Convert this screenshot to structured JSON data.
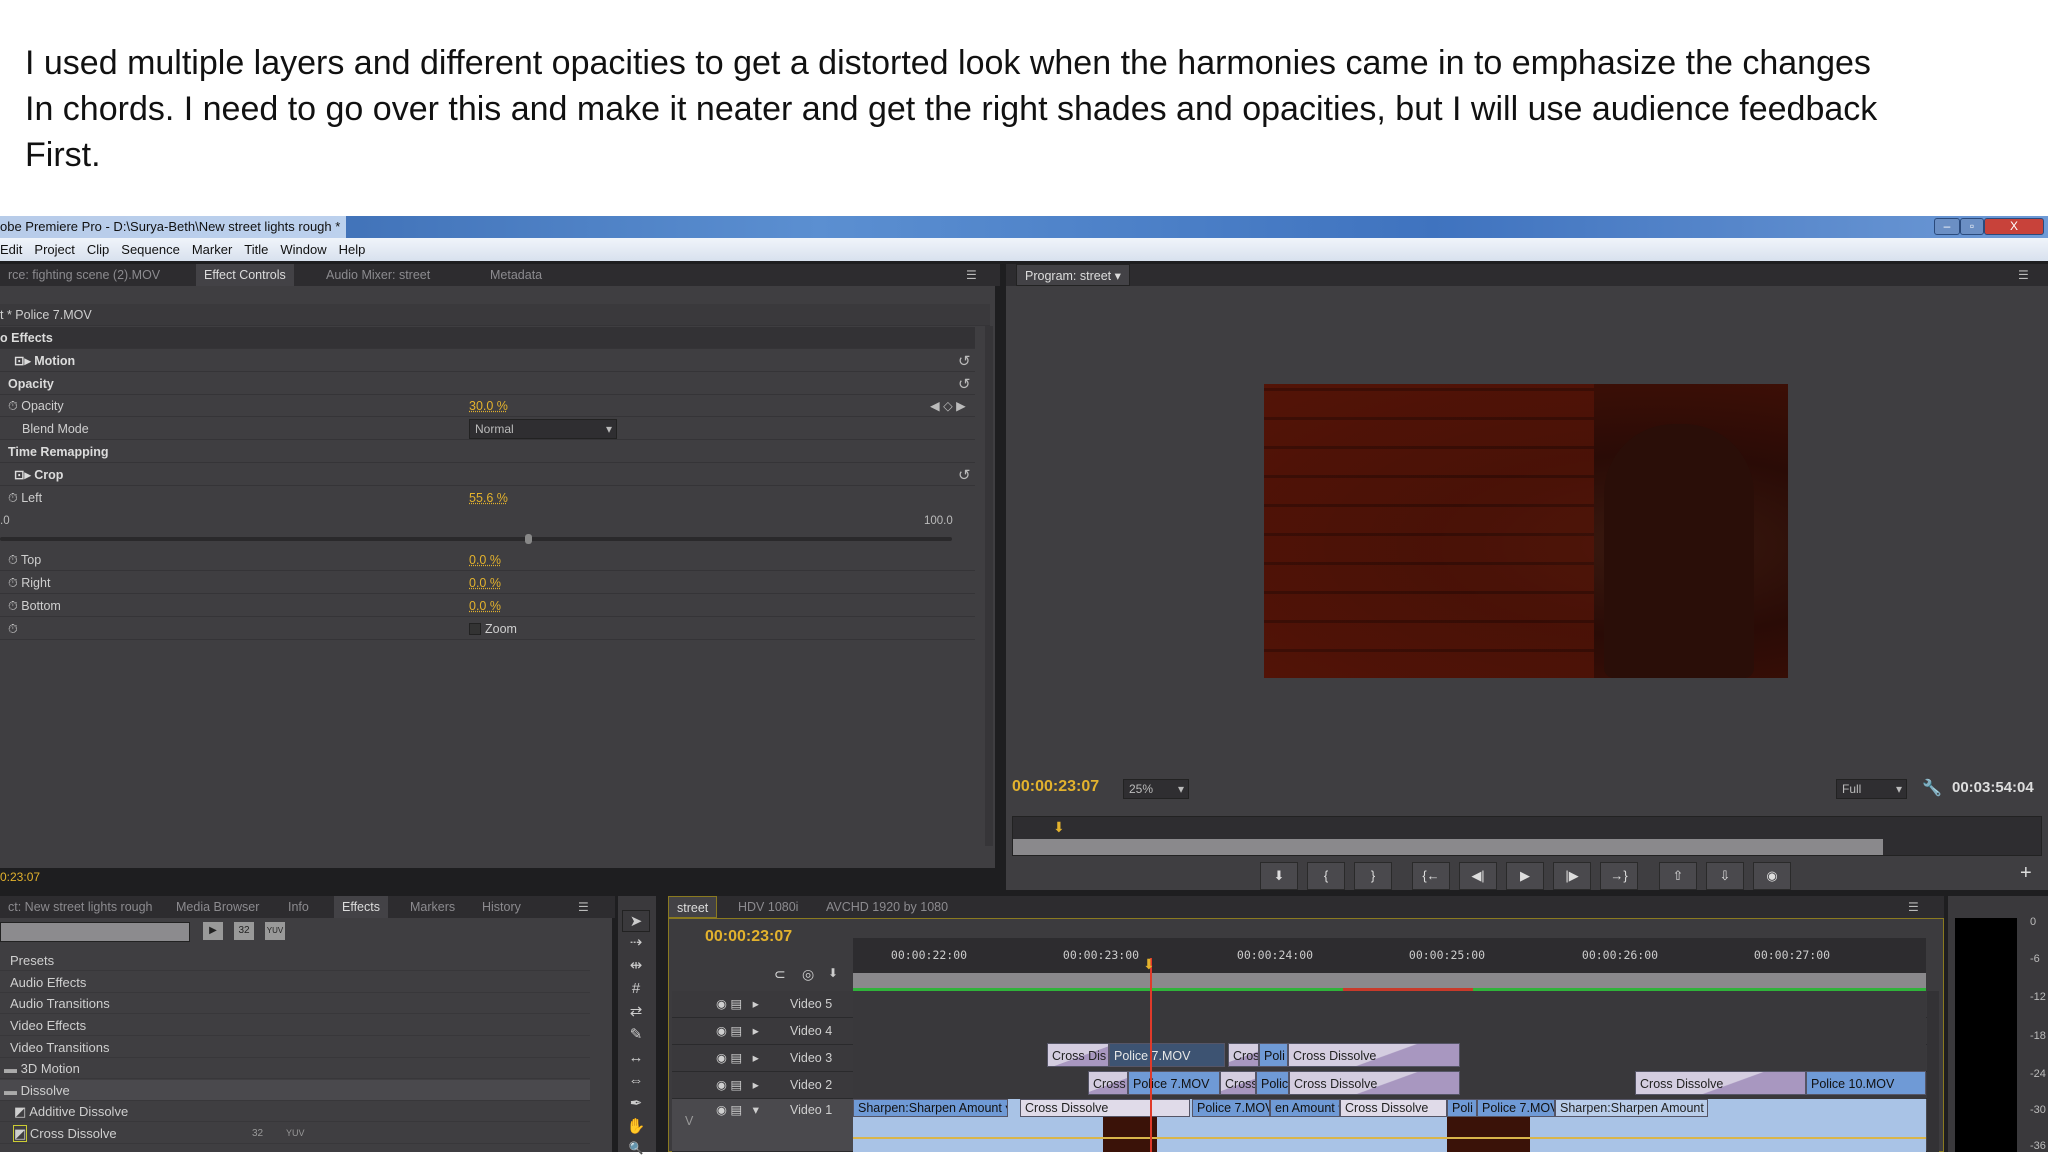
{
  "note": {
    "lines": [
      "I used multiple layers  and different opacities to get a distorted look when the harmonies came in to emphasize the  changes",
      "In chords. I need to go over this and make it neater and get the right shades and opacities, but I will use audience feedback",
      "First."
    ]
  },
  "window": {
    "title": "obe Premiere Pro - D:\\Surya-Beth\\New street lights rough *",
    "min": "–",
    "max": "▫",
    "close": "X"
  },
  "menu": [
    "Edit",
    "Project",
    "Clip",
    "Sequence",
    "Marker",
    "Title",
    "Window",
    "Help"
  ],
  "source_tabs": [
    "rce: fighting scene (2).MOV",
    "Effect Controls",
    "Audio Mixer: street",
    "Metadata"
  ],
  "effect_controls": {
    "clip": "t * Police 7.MOV",
    "section": "o Effects",
    "motion": "Motion",
    "opacity_group": "Opacity",
    "opacity_label": "Opacity",
    "opacity_value": "30.0 %",
    "blend_label": "Blend Mode",
    "blend_value": "Normal",
    "time_remap": "Time Remapping",
    "crop": "Crop",
    "left_label": "Left",
    "left_value": "55.6 %",
    "slider_min": ".0",
    "slider_max": "100.0",
    "slider_value": 55.6,
    "top_label": "Top",
    "top_value": "0.0 %",
    "right_label": "Right",
    "right_value": "0.0 %",
    "bottom_label": "Bottom",
    "bottom_value": "0.0 %",
    "zoom_label": "Zoom",
    "zoom_checked": false,
    "timecode": "0:23:07"
  },
  "program": {
    "tab": "Program: street",
    "timecode": "00:00:23:07",
    "zoom": "25%",
    "quality": "Full",
    "duration": "00:03:54:04",
    "buttons": [
      "marker",
      "mark-in",
      "mark-out",
      "go-to-in",
      "step-back",
      "play",
      "step-forward",
      "go-to-out",
      "lift",
      "extract",
      "export-frame"
    ],
    "button_glyphs": [
      "⬇",
      "{",
      "}",
      "{←",
      "◀|",
      "▶",
      "|▶",
      "→}",
      "⇧",
      "⇩",
      "◉"
    ],
    "add": "+"
  },
  "project_tabs": [
    "ct: New street lights rough",
    "Media Browser",
    "Info",
    "Effects",
    "Markers",
    "History"
  ],
  "effects_icons": [
    "▶",
    "32",
    "YUV"
  ],
  "effects_tree": [
    {
      "label": "Presets"
    },
    {
      "label": "Audio Effects"
    },
    {
      "label": "Audio Transitions"
    },
    {
      "label": "Video Effects"
    },
    {
      "label": "Video Transitions"
    },
    {
      "label": "3D Motion"
    },
    {
      "label": "Dissolve"
    },
    {
      "label": "Additive Dissolve"
    },
    {
      "label": "Cross Dissolve",
      "badges": [
        "32",
        "YUV"
      ]
    }
  ],
  "tools": [
    "selection",
    "track-select",
    "ripple-edit",
    "rolling-edit",
    "rate-stretch",
    "razor",
    "slip",
    "slide",
    "pen",
    "hand",
    "zoom"
  ],
  "tool_glyphs": [
    "➤",
    "⇢",
    "⇹",
    "#",
    "⇄",
    "✎",
    "↔",
    "⇔",
    "✒",
    "✋",
    "🔍"
  ],
  "timeline": {
    "tabs": [
      "street",
      "HDV 1080i",
      "AVCHD 1920 by 1080"
    ],
    "timecode": "00:00:23:07",
    "ruler": [
      "00:00:22:00",
      "00:00:23:00",
      "00:00:24:00",
      "00:00:25:00",
      "00:00:26:00",
      "00:00:27:00"
    ],
    "tracks": [
      "Video 5",
      "Video 4",
      "Video 3",
      "Video 2",
      "Video 1"
    ],
    "target": "V",
    "video3": [
      "Cross Dis",
      "Police 7.MOV",
      "Cross",
      "Poli",
      "Cross Dissolve"
    ],
    "video2": [
      "Cross",
      "Police 7.MOV",
      "Cross",
      "Polic",
      "Cross Dissolve",
      "Cross Dissolve",
      "Police 10.MOV"
    ],
    "video1": [
      "Sharpen:Sharpen Amount ▾",
      "Cross Dissolve",
      "Police 7.MOV",
      "en Amount ▾",
      "Cross Dissolve",
      "Poli",
      "Police 7.MOV",
      "Sharpen:Sharpen Amount ▾"
    ]
  },
  "meter": [
    "0",
    "-6",
    "-12",
    "-18",
    "-24",
    "-30",
    "-36"
  ]
}
